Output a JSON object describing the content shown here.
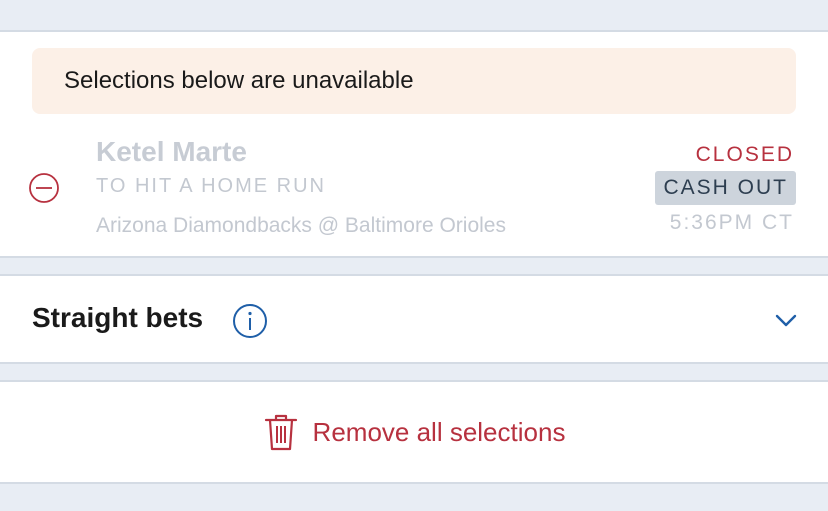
{
  "unavailable": {
    "notice": "Selections below are unavailable",
    "selection": {
      "player": "Ketel Marte",
      "market": "TO HIT A HOME RUN",
      "matchup": "Arizona Diamondbacks @ Baltimore Orioles",
      "status": "CLOSED",
      "cashout_label": "CASH OUT",
      "time": "5:36PM CT"
    }
  },
  "straight_bets": {
    "label": "Straight bets"
  },
  "actions": {
    "remove_all_label": "Remove all selections"
  },
  "colors": {
    "accent_red": "#b7313f",
    "accent_blue": "#1f5fa8",
    "notice_bg": "#fcf0e7",
    "page_bg": "#e8edf4"
  },
  "icons": {
    "remove": "minus-circle-icon",
    "info": "info-icon",
    "expand": "chevron-down-icon",
    "trash": "trash-icon"
  }
}
